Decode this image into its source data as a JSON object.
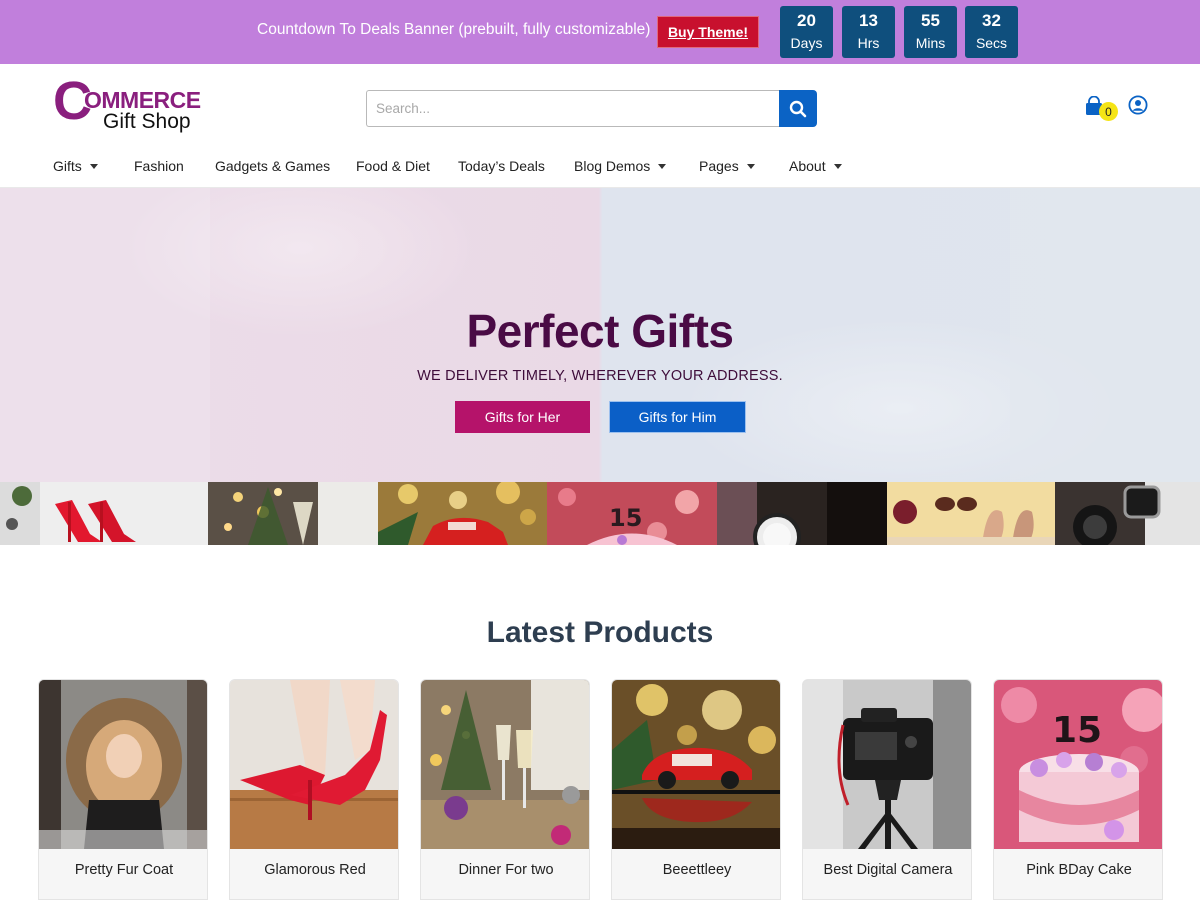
{
  "banner": {
    "text": "Countdown To Deals Banner (prebuilt, fully customizable)",
    "button_label": "Buy Theme!",
    "countdown": [
      {
        "value": "20",
        "unit": "Days"
      },
      {
        "value": "13",
        "unit": "Hrs"
      },
      {
        "value": "55",
        "unit": "Mins"
      },
      {
        "value": "32",
        "unit": "Secs"
      }
    ]
  },
  "header": {
    "logo_c": "C",
    "logo_ommerce": "OMMERCE",
    "logo_sub": "Gift Shop",
    "search_placeholder": "Search...",
    "cart_count": "0"
  },
  "nav": [
    {
      "label": "Gifts",
      "dropdown": true
    },
    {
      "label": "Fashion",
      "dropdown": false
    },
    {
      "label": "Gadgets & Games",
      "dropdown": false
    },
    {
      "label": "Food & Diet",
      "dropdown": false
    },
    {
      "label": "Today’s Deals",
      "dropdown": false
    },
    {
      "label": "Blog Demos",
      "dropdown": true
    },
    {
      "label": "Pages",
      "dropdown": true
    },
    {
      "label": "About",
      "dropdown": true
    }
  ],
  "hero": {
    "title": "Perfect Gifts",
    "subtitle": "WE DELIVER TIMELY, WHEREVER YOUR ADDRESS.",
    "button_her": "Gifts for Her",
    "button_him": "Gifts for Him"
  },
  "latest": {
    "title": "Latest Products",
    "products": [
      {
        "name": "Pretty Fur Coat"
      },
      {
        "name": "Glamorous Red"
      },
      {
        "name": "Dinner For two"
      },
      {
        "name": "Beeettleey"
      },
      {
        "name": "Best Digital Camera"
      },
      {
        "name": "Pink BDay Cake"
      }
    ]
  },
  "colors": {
    "banner_bg": "#c17fdc",
    "buy_button": "#c8102e",
    "countdown_box": "#0f4f7d",
    "brand_purple": "#8a1f7e",
    "search_button": "#0b63c5",
    "hero_title": "#4a0b45",
    "btn_her": "#b5136a",
    "btn_him": "#0b5fc7",
    "cart_badge": "#f5e415"
  }
}
